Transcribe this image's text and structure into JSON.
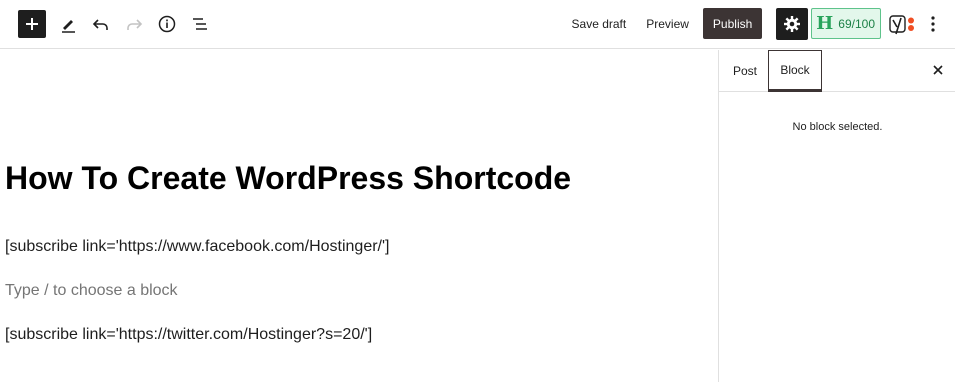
{
  "toolbar": {
    "left_icons": [
      "plus-icon",
      "pencil-icon",
      "undo-icon",
      "redo-icon",
      "info-icon",
      "list-view-icon"
    ],
    "save_draft": "Save draft",
    "preview": "Preview",
    "publish": "Publish",
    "hemingway_letter": "H",
    "hemingway_score": "69/100",
    "yoast_letter": "y"
  },
  "editor": {
    "title": "How To Create WordPress Shortcode",
    "paragraph_1": "[subscribe link='https://www.facebook.com/Hostinger/']",
    "placeholder": "Type / to choose a block",
    "paragraph_2": "[subscribe link='https://twitter.com/Hostinger?s=20/']"
  },
  "sidebar": {
    "tabs": [
      {
        "label": "Post",
        "active": false
      },
      {
        "label": "Block",
        "active": true
      }
    ],
    "empty_message": "No block selected."
  },
  "colors": {
    "publish_bg": "#3c3434",
    "hemingway_green": "#29a35c",
    "yoast_orange": "#f04e23"
  }
}
